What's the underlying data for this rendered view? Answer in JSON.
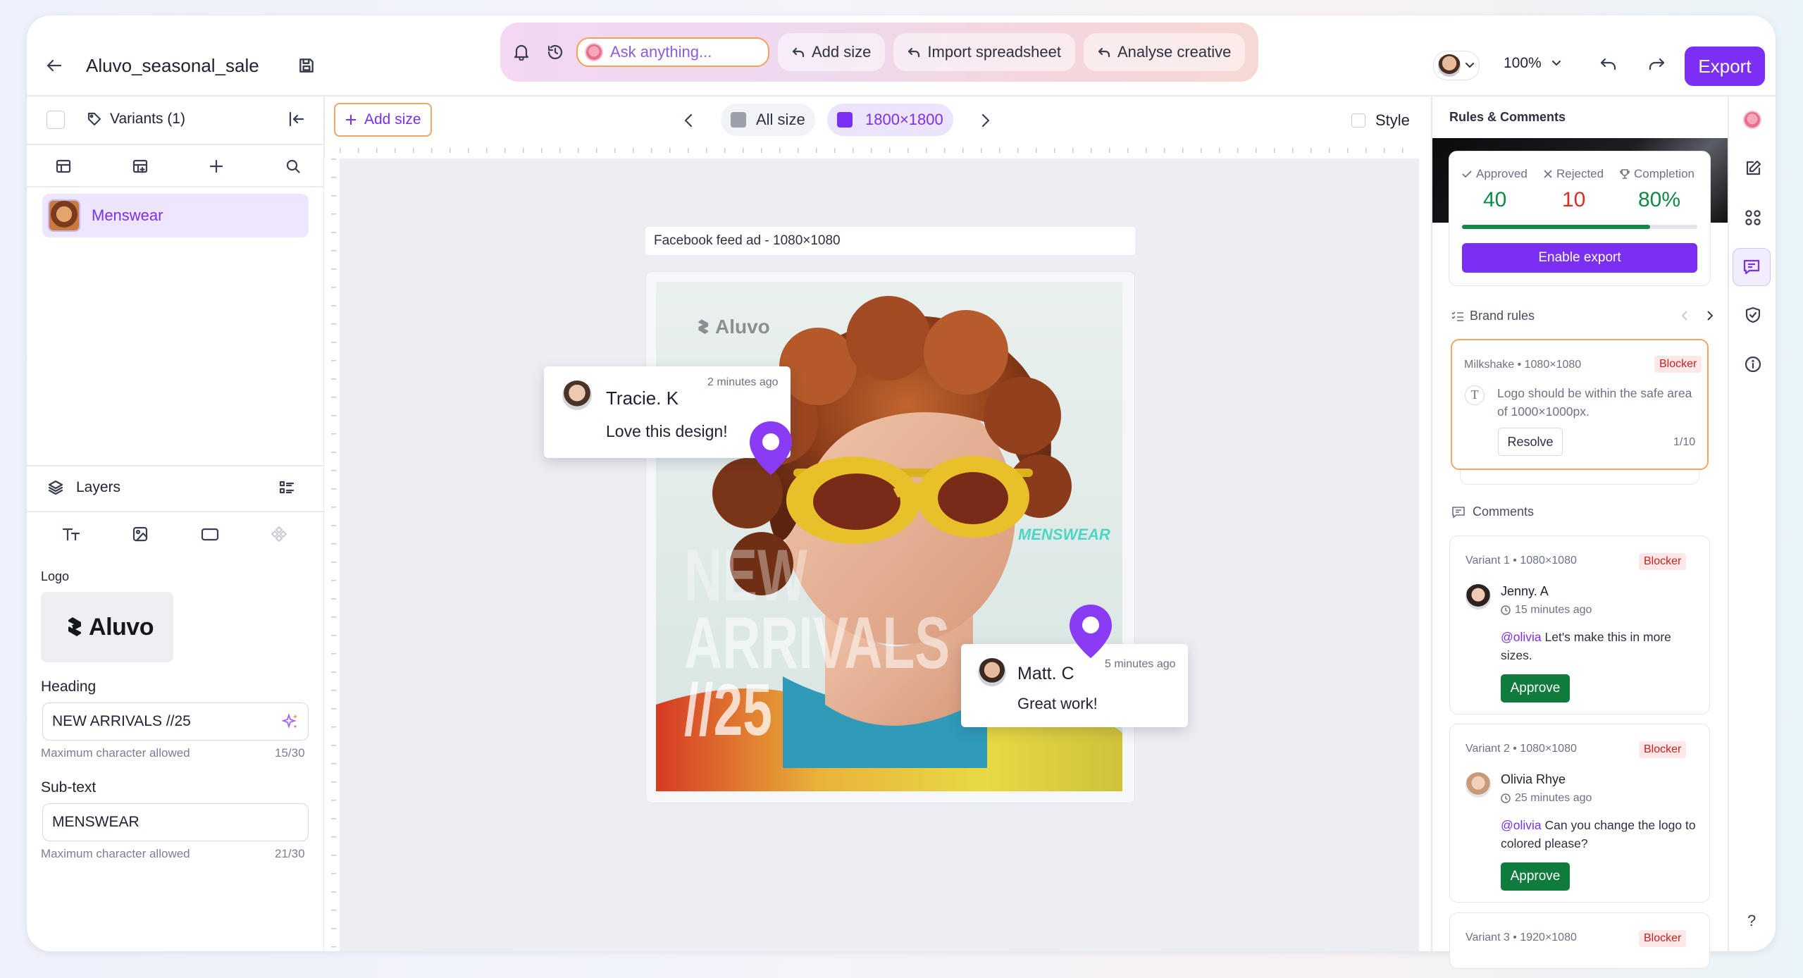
{
  "toolbar": {
    "ask_placeholder": "Ask anything...",
    "add_size": "Add size",
    "import": "Import spreadsheet",
    "analyse": "Analyse creative"
  },
  "header": {
    "file_name": "Aluvo_seasonal_sale",
    "zoom": "100%",
    "export_label": "Export"
  },
  "left": {
    "variants_label": "Variants (1)",
    "item_label": "Menswear",
    "layers_label": "Layers",
    "logo_label": "Logo",
    "logo_text": "Aluvo",
    "heading_label": "Heading",
    "heading_value": "NEW ARRIVALS //25",
    "heading_hint": "Maximum character allowed",
    "heading_count": "15/30",
    "subtext_label": "Sub-text",
    "subtext_value": "MENSWEAR",
    "subtext_hint": "Maximum character allowed",
    "subtext_count": "21/30"
  },
  "canvas_bar": {
    "add_size": "Add size",
    "all_size": "All size",
    "current_size": "1800×1800",
    "style_label": "Style"
  },
  "artboard": {
    "label": "Facebook feed ad - 1080×1080",
    "brand": "Aluvo",
    "tagline": "MENSWEAR",
    "headline_1": "NEW",
    "headline_2": "ARRIVALS",
    "headline_3": "//25"
  },
  "comments_on_canvas": [
    {
      "name": "Tracie. K",
      "time": "2 minutes ago",
      "text": "Love this design!"
    },
    {
      "name": "Matt. C",
      "time": "5 minutes ago",
      "text": "Great work!"
    }
  ],
  "right": {
    "title": "Rules & Comments",
    "stats": {
      "approved_label": "Approved",
      "approved": "40",
      "rejected_label": "Rejected",
      "rejected": "10",
      "completion_label": "Completion",
      "completion": "80%",
      "completion_fraction": 0.8
    },
    "enable_export": "Enable export",
    "brand_rules_label": "Brand rules",
    "rule": {
      "source": "Milkshake • 1080×1080",
      "tag": "Blocker",
      "text": "Logo should be within the safe area of 1000×1000px.",
      "resolve": "Resolve",
      "count": "1/10"
    },
    "comments_label": "Comments",
    "comments": [
      {
        "variant": "Variant 1 • 1080×1080",
        "tag": "Blocker",
        "name": "Jenny. A",
        "time": "15 minutes ago",
        "mention": "@olivia",
        "text": " Let's make this in more sizes.",
        "approve": "Approve"
      },
      {
        "variant": "Variant 2 • 1080×1080",
        "tag": "Blocker",
        "name": "Olivia Rhye",
        "time": "25 minutes ago",
        "mention": "@olivia",
        "text": " Can you change the logo to colored please?",
        "approve": "Approve"
      },
      {
        "variant": "Variant 3 • 1920×1080",
        "tag": "Blocker"
      }
    ],
    "help": "?"
  },
  "colors": {
    "accent": "#7b2ff2",
    "approved": "#0f8a45",
    "rejected": "#d93025",
    "blocker": "#c5221f"
  },
  "icons": [
    "bell-icon",
    "history-icon",
    "ai-avatar-icon",
    "back-arrow-icon",
    "save-icon",
    "undo-icon",
    "redo-icon",
    "collapse-icon",
    "search-icon",
    "layers-icon",
    "pin-icon",
    "edit-icon",
    "grid-icon",
    "comment-icon",
    "shield-icon",
    "info-icon"
  ]
}
